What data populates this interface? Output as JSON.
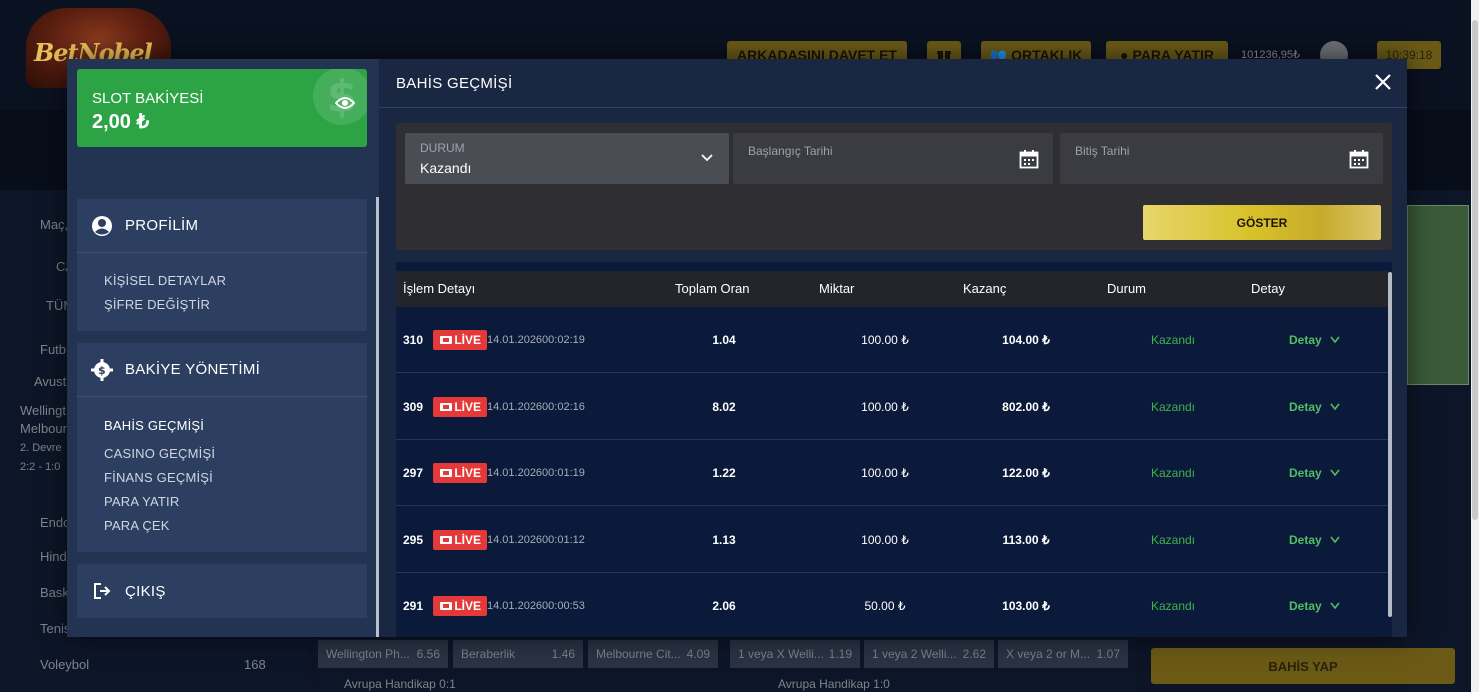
{
  "site": {
    "logo_text": "BetNobel",
    "top_buttons": [
      "ARKADAŞINI DAVET ET",
      "ORTAKLIK",
      "PARA YATIR"
    ],
    "balance": "101236,95₺",
    "time": "10:39:18",
    "left_menu_bg": [
      "Maç, tak",
      "CA",
      "TÜM",
      "Futb",
      "Avustr",
      "Wellingt",
      "Melbour",
      "2. Devre",
      "2:2 - 1:0",
      "Endon",
      "Hindis",
      "Bask",
      "Tenis",
      "Voleybol"
    ],
    "voleybol_count": "168",
    "odds": [
      {
        "label": "Wellington Ph...",
        "value": "6.56"
      },
      {
        "label": "Beraberlik",
        "value": "1.46"
      },
      {
        "label": "Melbourne Cit...",
        "value": "4.09"
      },
      {
        "label": "1 veya X Welli...",
        "value": "1.19"
      },
      {
        "label": "1 veya 2 Welli...",
        "value": "2.62"
      },
      {
        "label": "X veya 2 or M...",
        "value": "1.07"
      }
    ],
    "bottom_row_left": "Avrupa Handikap 0:1",
    "bottom_row_right": "Avrupa Handikap 1:0",
    "bet_button": "BAHİS YAP"
  },
  "sidebar": {
    "slot_title": "SLOT BAKİYESİ",
    "slot_value": "2,00 ₺",
    "profile": {
      "title": "PROFİLİM",
      "links": [
        "KİŞİSEL DETAYLAR",
        "ŞİFRE DEĞİŞTİR"
      ]
    },
    "balance": {
      "title": "BAKİYE YÖNETİMİ",
      "links": [
        "BAHİS GEÇMİŞİ",
        "CASINO GEÇMİŞİ",
        "FİNANS GEÇMİŞİ",
        "PARA YATIR",
        "PARA ÇEK"
      ]
    },
    "logout": "ÇIKIŞ"
  },
  "content": {
    "title": "BAHİS GEÇMİŞİ",
    "filters": {
      "status_label": "DURUM",
      "status_value": "Kazandı",
      "start_label": "Başlangıç Tarihi",
      "end_label": "Bitiş Tarihi",
      "show_button": "GÖSTER"
    },
    "columns": [
      "İşlem Detayı",
      "Toplam Oran",
      "Miktar",
      "Kazanç",
      "Durum",
      "Detay"
    ],
    "rows": [
      {
        "id": "310",
        "badge": "LİVE",
        "date": "14.01.202600:02:19",
        "odds": "1.04",
        "amount": "100.00 ₺",
        "win": "104.00 ₺",
        "status": "Kazandı",
        "detail": "Detay"
      },
      {
        "id": "309",
        "badge": "LİVE",
        "date": "14.01.202600:02:16",
        "odds": "8.02",
        "amount": "100.00 ₺",
        "win": "802.00 ₺",
        "status": "Kazandı",
        "detail": "Detay"
      },
      {
        "id": "297",
        "badge": "LİVE",
        "date": "14.01.202600:01:19",
        "odds": "1.22",
        "amount": "100.00 ₺",
        "win": "122.00 ₺",
        "status": "Kazandı",
        "detail": "Detay"
      },
      {
        "id": "295",
        "badge": "LİVE",
        "date": "14.01.202600:01:12",
        "odds": "1.13",
        "amount": "100.00 ₺",
        "win": "113.00 ₺",
        "status": "Kazandı",
        "detail": "Detay"
      },
      {
        "id": "291",
        "badge": "LİVE",
        "date": "14.01.202600:00:53",
        "odds": "2.06",
        "amount": "50.00 ₺",
        "win": "103.00 ₺",
        "status": "Kazandı",
        "detail": "Detay"
      }
    ]
  },
  "colors": {
    "accent_gold": "#d8c22a",
    "success_green": "#3fb04f",
    "slot_green": "#2ca345",
    "live_red": "#e53838"
  }
}
